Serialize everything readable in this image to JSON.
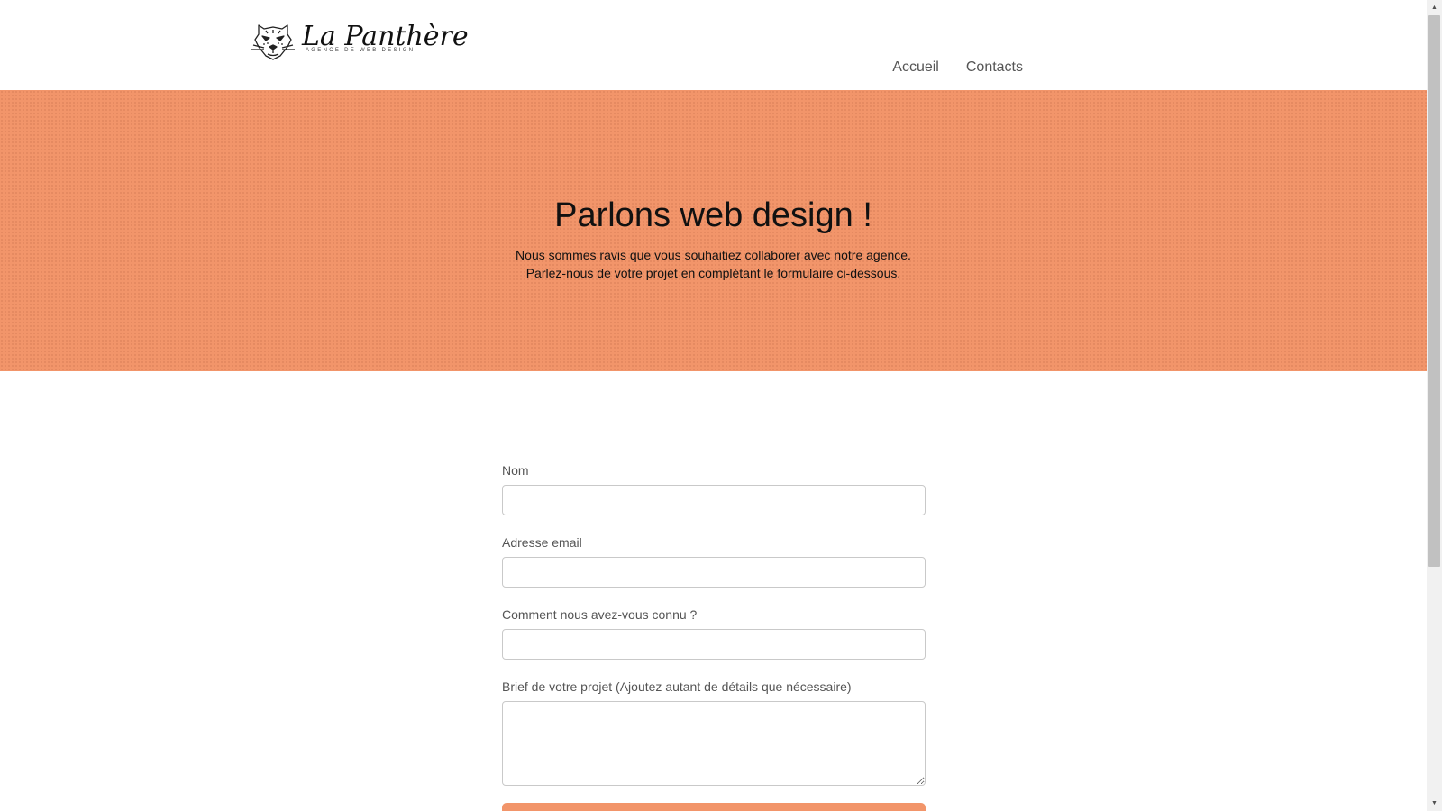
{
  "brand": {
    "name": "La Panthère",
    "tagline": "AGENCE DE WEB DESIGN",
    "icon": "panther-head-icon"
  },
  "nav": {
    "items": [
      {
        "label": "Accueil"
      },
      {
        "label": "Contacts"
      }
    ]
  },
  "hero": {
    "title": "Parlons web design !",
    "subtitle_line1": "Nous sommes ravis que vous souhaitiez collaborer avec notre agence.",
    "subtitle_line2": "Parlez-nous de votre projet en complétant le formulaire ci-dessous.",
    "background_color": "#f2956a"
  },
  "form": {
    "fields": [
      {
        "label": "Nom",
        "value": ""
      },
      {
        "label": "Adresse email",
        "value": ""
      },
      {
        "label": "Comment nous avez-vous connu ?",
        "value": ""
      },
      {
        "label": "Brief de votre projet (Ajoutez autant de détails que nécessaire)",
        "value": ""
      }
    ],
    "submit_color": "#f2956a"
  }
}
